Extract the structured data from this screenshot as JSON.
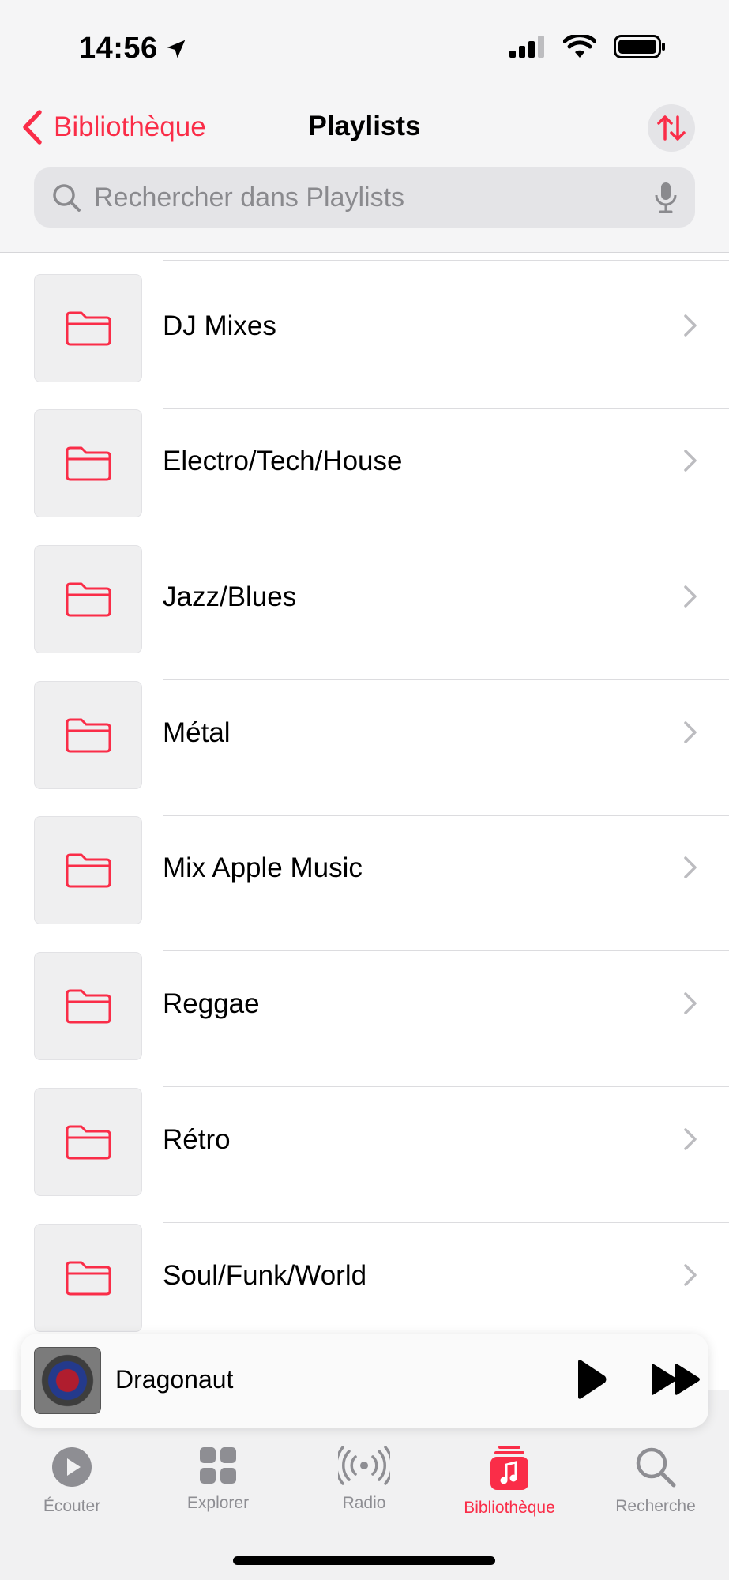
{
  "status_bar": {
    "time": "14:56",
    "icons": [
      "location-arrow-icon",
      "cellular-signal-icon",
      "wifi-icon",
      "battery-icon"
    ]
  },
  "nav": {
    "back_label": "Bibliothèque",
    "title": "Playlists",
    "sort_icon": "sort-arrows-icon"
  },
  "search": {
    "placeholder": "Rechercher dans Playlists"
  },
  "playlists": [
    {
      "label": "DJ Mixes",
      "icon": "folder-icon"
    },
    {
      "label": "Electro/Tech/House",
      "icon": "folder-icon"
    },
    {
      "label": "Jazz/Blues",
      "icon": "folder-icon"
    },
    {
      "label": "Métal",
      "icon": "folder-icon"
    },
    {
      "label": "Mix Apple Music",
      "icon": "folder-icon"
    },
    {
      "label": "Reggae",
      "icon": "folder-icon"
    },
    {
      "label": "Rétro",
      "icon": "folder-icon"
    },
    {
      "label": "Soul/Funk/World",
      "icon": "folder-icon"
    }
  ],
  "mini_player": {
    "title": "Dragonaut"
  },
  "tabs": [
    {
      "label": "Écouter",
      "icon": "play-circle-icon",
      "active": false
    },
    {
      "label": "Explorer",
      "icon": "grid-icon",
      "active": false
    },
    {
      "label": "Radio",
      "icon": "radio-waves-icon",
      "active": false
    },
    {
      "label": "Bibliothèque",
      "icon": "music-library-icon",
      "active": true
    },
    {
      "label": "Recherche",
      "icon": "search-icon",
      "active": false
    }
  ],
  "colors": {
    "accent": "#fa2d48",
    "inactive": "#8e8e93"
  }
}
